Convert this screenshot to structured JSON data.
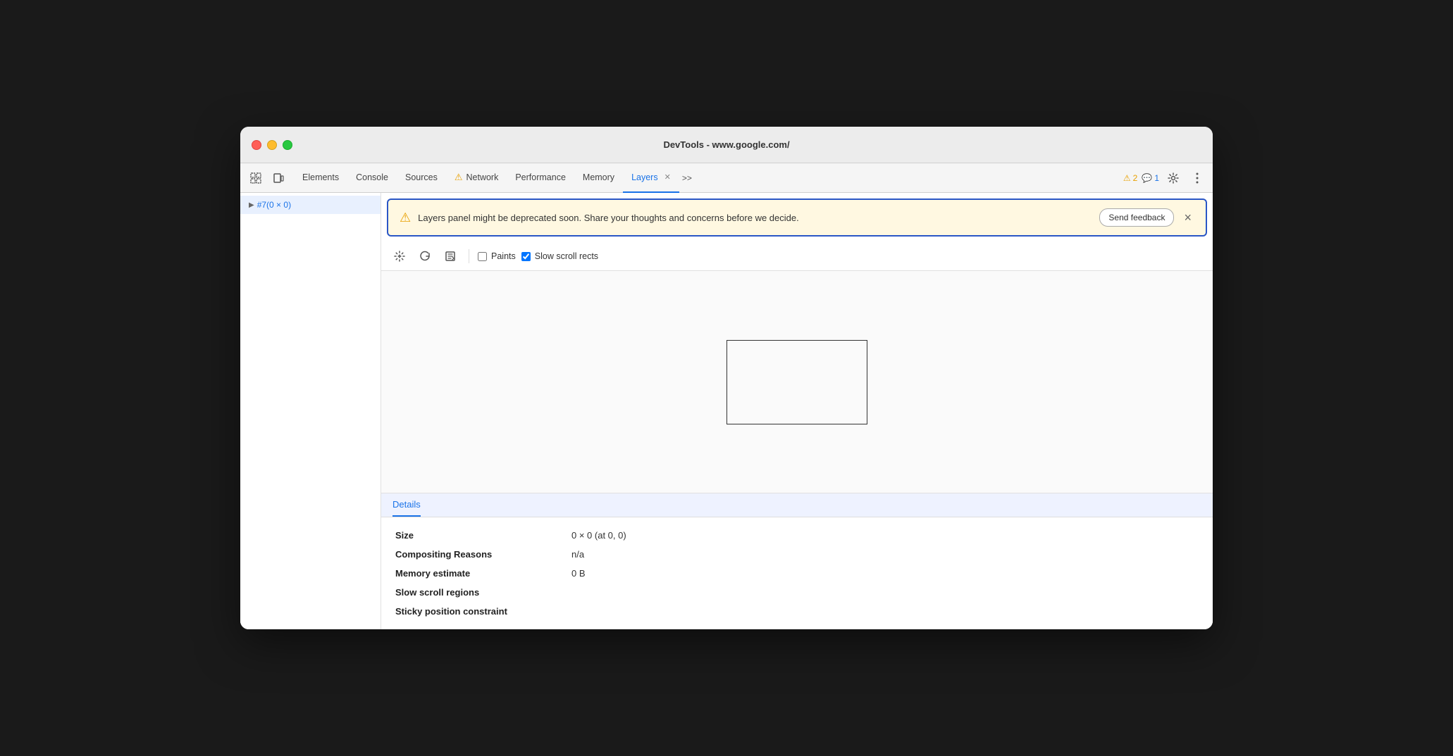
{
  "window": {
    "title": "DevTools - www.google.com/"
  },
  "traffic_lights": {
    "close_label": "close",
    "minimize_label": "minimize",
    "maximize_label": "maximize"
  },
  "tabs": [
    {
      "id": "elements",
      "label": "Elements",
      "active": false,
      "has_warning": false,
      "closeable": false
    },
    {
      "id": "console",
      "label": "Console",
      "active": false,
      "has_warning": false,
      "closeable": false
    },
    {
      "id": "sources",
      "label": "Sources",
      "active": false,
      "has_warning": false,
      "closeable": false
    },
    {
      "id": "network",
      "label": "Network",
      "active": false,
      "has_warning": true,
      "closeable": false
    },
    {
      "id": "performance",
      "label": "Performance",
      "active": false,
      "has_warning": false,
      "closeable": false
    },
    {
      "id": "memory",
      "label": "Memory",
      "active": false,
      "has_warning": false,
      "closeable": false
    },
    {
      "id": "layers",
      "label": "Layers",
      "active": true,
      "has_warning": false,
      "closeable": true
    }
  ],
  "more_tabs_label": ">>",
  "badges": {
    "warning_count": "2",
    "info_count": "1"
  },
  "sidebar": {
    "items": [
      {
        "id": "layer-1",
        "label": "#7(0 × 0)",
        "selected": true,
        "arrow": "▶"
      }
    ]
  },
  "warning_banner": {
    "message": "Layers panel might be deprecated soon. Share your thoughts and concerns before we decide.",
    "send_feedback_label": "Send feedback",
    "close_label": "×"
  },
  "toolbar": {
    "pan_label": "pan",
    "rotate_label": "rotate",
    "reset_label": "reset-zoom",
    "paints_label": "Paints",
    "slow_scroll_label": "Slow scroll rects",
    "paints_checked": false,
    "slow_scroll_checked": true
  },
  "details": {
    "tab_label": "Details",
    "rows": [
      {
        "label": "Size",
        "value": "0 × 0 (at 0, 0)"
      },
      {
        "label": "Compositing Reasons",
        "value": "n/a"
      },
      {
        "label": "Memory estimate",
        "value": "0 B"
      },
      {
        "label": "Slow scroll regions",
        "value": ""
      },
      {
        "label": "Sticky position constraint",
        "value": ""
      }
    ]
  }
}
